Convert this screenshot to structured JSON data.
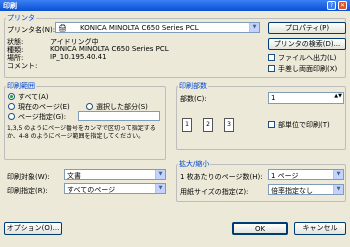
{
  "window": {
    "title": "印刷",
    "help_icon": "help-icon",
    "close_icon": "close-icon"
  },
  "printer": {
    "legend": "プリンタ",
    "name_label": "プリンタ名(N):",
    "name_value": "KONICA MINOLTA C650 Series PCL",
    "status_label": "状態:",
    "status_value": "アイドリング中",
    "type_label": "種類:",
    "type_value": "KONICA MINOLTA C650 Series PCL",
    "location_label": "場所:",
    "location_value": "IP_10.195.40.41",
    "comment_label": "コメント:",
    "comment_value": "",
    "properties_button": "プロパティ(P)",
    "find_button": "プリンタの検索(D)...",
    "print_to_file": "ファイルへ出力(L)",
    "manual_duplex": "手差し両面印刷(X)"
  },
  "range": {
    "legend": "印刷範囲",
    "all": "すべて(A)",
    "current": "現在のページ(E)",
    "selection": "選択した部分(S)",
    "pages": "ページ指定(G):",
    "pages_value": "",
    "hint": "1,3,5 のようにページ番号をカンマで区切って指定するか、4-8 のようにページ範囲を指定してください。"
  },
  "copies": {
    "legend": "印刷部数",
    "count_label": "部数(C):",
    "count_value": "1",
    "collate": "部単位で印刷(T)"
  },
  "print_what_label": "印刷対象(W):",
  "print_what_value": "文書",
  "print_label": "印刷指定(R):",
  "print_value": "すべてのページ",
  "zoom": {
    "legend": "拡大/縮小",
    "pages_per_sheet_label": "1 枚あたりのページ数(H):",
    "pages_per_sheet_value": "1 ページ",
    "scale_label": "用紙サイズの指定(Z):",
    "scale_value": "倍率指定なし"
  },
  "buttons": {
    "options": "オプション(O)...",
    "ok": "OK",
    "cancel": "キャンセル"
  }
}
